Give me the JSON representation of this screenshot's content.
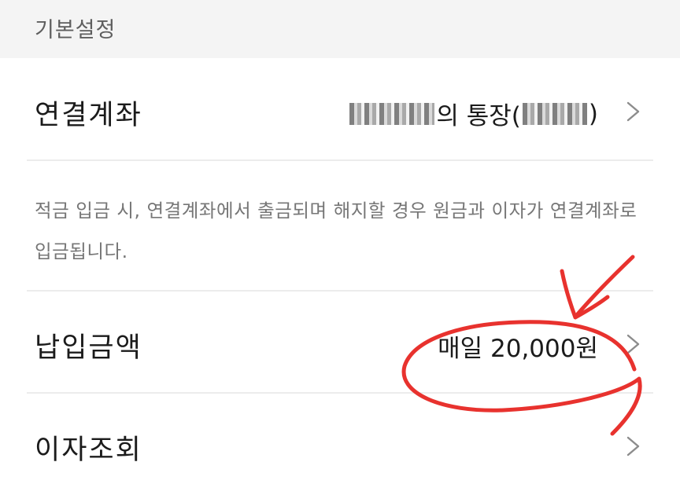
{
  "section": {
    "title": "기본설정"
  },
  "linked_account": {
    "label": "연결계좌",
    "value_suffix": "의 통장(",
    "value_close": ")"
  },
  "notice": {
    "text": "적금 입금 시, 연결계좌에서 출금되며 해지할 경우 원금과 이자가 연결계좌로 입금됩니다."
  },
  "payment_amount": {
    "label": "납입금액",
    "value": "매일 20,000원"
  },
  "interest_inquiry": {
    "label": "이자조회"
  },
  "icons": {
    "chevron": "chevron-right-icon"
  },
  "colors": {
    "header_bg": "#f4f4f4",
    "annotation": "#e8322e",
    "divider": "#ececec"
  }
}
